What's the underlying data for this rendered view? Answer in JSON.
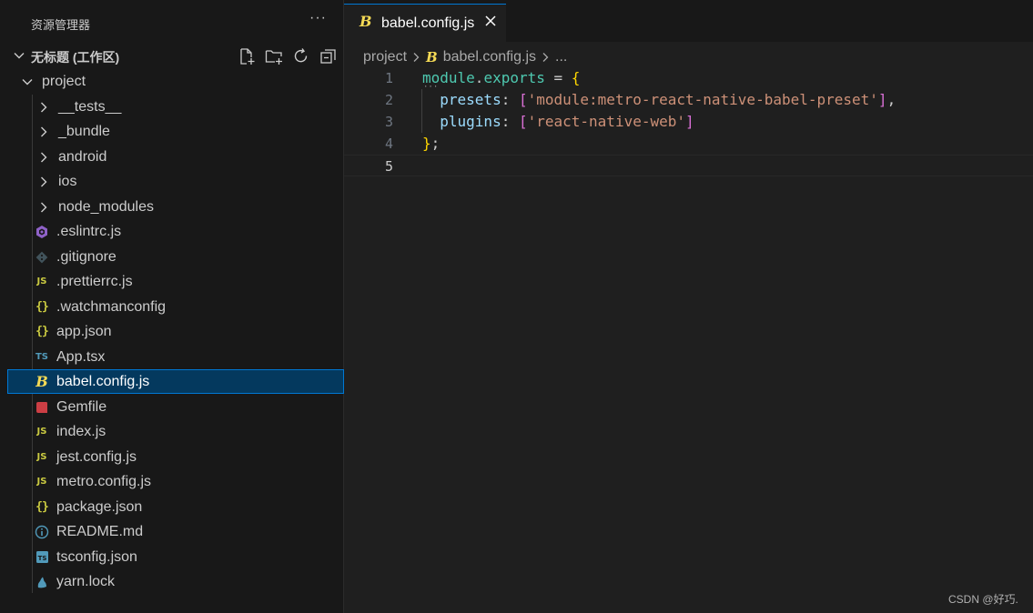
{
  "sidebar": {
    "title": "资源管理器",
    "more": "···",
    "workspace": "无标题 (工作区)",
    "actions": [
      "new-file-icon",
      "new-folder-icon",
      "refresh-icon",
      "collapse-all-icon"
    ],
    "root": "project",
    "items": [
      {
        "name": "__tests__",
        "kind": "folder"
      },
      {
        "name": "_bundle",
        "kind": "folder"
      },
      {
        "name": "android",
        "kind": "folder"
      },
      {
        "name": "ios",
        "kind": "folder"
      },
      {
        "name": "node_modules",
        "kind": "folder"
      },
      {
        "name": ".eslintrc.js",
        "kind": "eslint"
      },
      {
        "name": ".gitignore",
        "kind": "git"
      },
      {
        "name": ".prettierrc.js",
        "kind": "js"
      },
      {
        "name": ".watchmanconfig",
        "kind": "json"
      },
      {
        "name": "app.json",
        "kind": "json"
      },
      {
        "name": "App.tsx",
        "kind": "ts"
      },
      {
        "name": "babel.config.js",
        "kind": "babel",
        "selected": true
      },
      {
        "name": "Gemfile",
        "kind": "ruby"
      },
      {
        "name": "index.js",
        "kind": "js"
      },
      {
        "name": "jest.config.js",
        "kind": "js"
      },
      {
        "name": "metro.config.js",
        "kind": "js"
      },
      {
        "name": "package.json",
        "kind": "json"
      },
      {
        "name": "README.md",
        "kind": "info"
      },
      {
        "name": "tsconfig.json",
        "kind": "tsconfig"
      },
      {
        "name": "yarn.lock",
        "kind": "yarn"
      }
    ],
    "badges": {
      "js": "JS",
      "ts": "TS",
      "json": "{}",
      "babel": "B"
    }
  },
  "editor": {
    "tab": {
      "label": "babel.config.js"
    },
    "breadcrumb": [
      "project",
      "babel.config.js",
      "..."
    ],
    "line_numbers": [
      "1",
      "2",
      "3",
      "4",
      "5"
    ],
    "active_line": 5,
    "code": {
      "l1_var": "module",
      "l1_dot": ".",
      "l1_prop": "exports",
      "l1_eq": " = ",
      "l1_brace": "{",
      "l2_indent": "  ",
      "l2_key": "presets",
      "l2_colon": ": ",
      "l2_open": "[",
      "l2_str": "'module:metro-react-native-babel-preset'",
      "l2_close": "]",
      "l2_comma": ",",
      "l3_indent": "  ",
      "l3_key": "plugins",
      "l3_colon": ": ",
      "l3_open": "[",
      "l3_str": "'react-native-web'",
      "l3_close": "]",
      "l4_brace": "}",
      "l4_semi": ";"
    },
    "hint_dots": "···"
  },
  "watermark": "CSDN @好巧.",
  "colors": {
    "accent": "#0078d4",
    "selection": "#04395e",
    "js": "#cbcb41",
    "ts": "#519aba",
    "string": "#ce9178",
    "property": "#9cdcfe",
    "variable": "#4ec9b0",
    "brace": "#ffd700",
    "bracket": "#da70d6"
  }
}
